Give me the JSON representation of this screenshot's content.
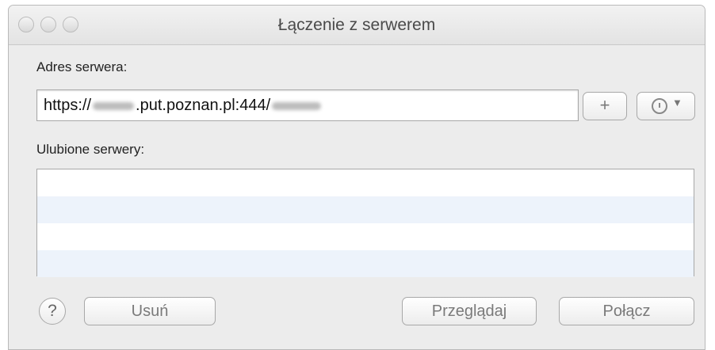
{
  "window": {
    "title": "Łączenie z serwerem"
  },
  "server_address": {
    "label": "Adres serwera:",
    "value_prefix": "https://",
    "value_middle": ".put.poznan.pl:444/",
    "redacted": true
  },
  "favorites": {
    "label": "Ulubione serwery:",
    "rows": [
      "",
      "",
      "",
      ""
    ]
  },
  "buttons": {
    "add_label": "+",
    "remove_label": "Usuń",
    "browse_label": "Przeglądaj",
    "connect_label": "Połącz",
    "help_label": "?"
  },
  "icons": {
    "history": "clock-icon",
    "dropdown": "chevron-down-icon"
  }
}
